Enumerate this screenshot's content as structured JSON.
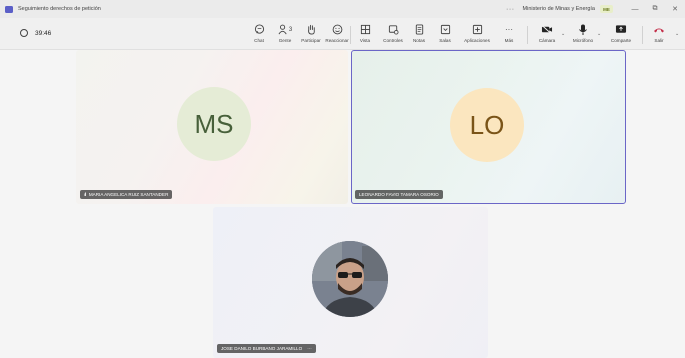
{
  "window": {
    "title": "Seguimiento derechos de petición",
    "more": "···",
    "org": "Ministerio de Minas y Energía",
    "org_badge": "ME",
    "min": "—",
    "restore": "⧉",
    "close": "✕"
  },
  "toolbar": {
    "timer": "39:46",
    "people_count": "3",
    "items": {
      "chat": "Chat",
      "people": "Gente",
      "raise": "Participar",
      "react": "Reaccionar",
      "view": "Vista",
      "controls": "Controles",
      "notes": "Notas",
      "rooms": "Salas",
      "apps": "Aplicaciones",
      "more": "Más",
      "camera": "Cámara",
      "mic": "Micrófono",
      "share": "Comparte",
      "leave": "Salir"
    }
  },
  "participants": [
    {
      "initials": "MS",
      "name": "MARIA ANGELICA RUIZ SANTANDER",
      "signal": "ıll"
    },
    {
      "initials": "LO",
      "name": "LEONARDO FAVIO TAMARA OSORIO"
    },
    {
      "name": "JOSE DANILO BURBANO JARAMILLO",
      "menu": "···"
    }
  ],
  "colors": {
    "accent": "#5b5fc7",
    "active_border": "#6b66c7",
    "leave_red": "#c4314b"
  }
}
